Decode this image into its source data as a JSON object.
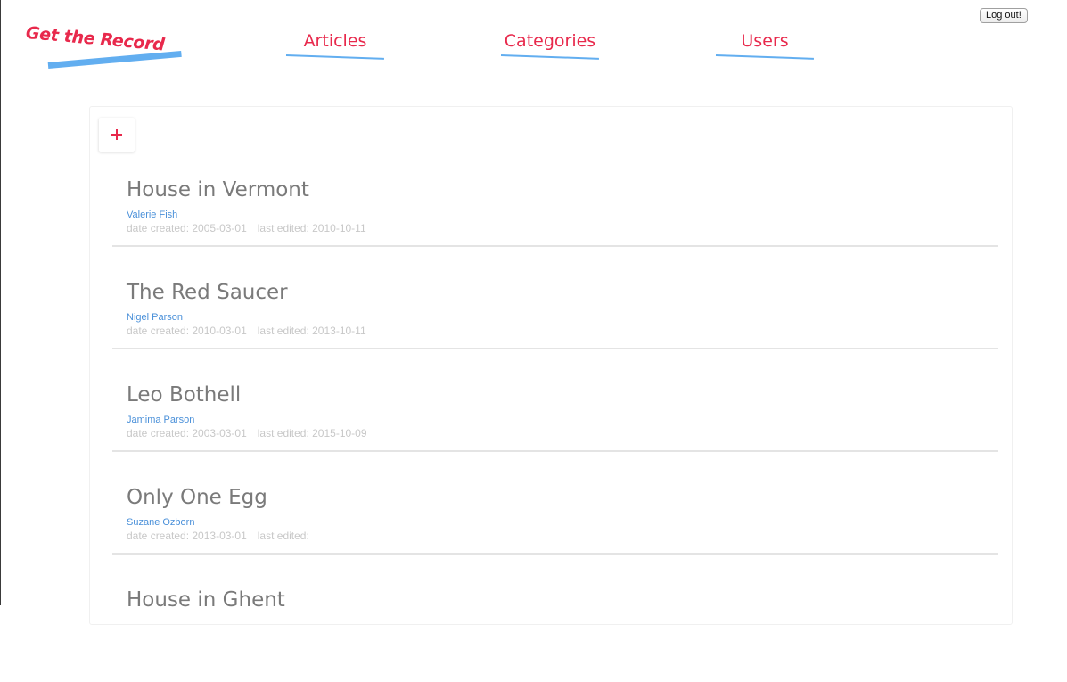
{
  "logo": {
    "text": "Get the Record",
    "colors": {
      "text": "#e8294c",
      "underline": "#62aef0"
    }
  },
  "nav": {
    "items": [
      {
        "label": "Articles"
      },
      {
        "label": "Categories"
      },
      {
        "label": "Users"
      }
    ]
  },
  "header": {
    "logout_label": "Log out!"
  },
  "toolbar": {
    "add_icon": "plus-icon"
  },
  "articles": [
    {
      "title": "House in Vermont",
      "author": "Valerie Fish",
      "created_label": "date created: 2005-03-01",
      "edited_label": "last edited: 2010-10-11"
    },
    {
      "title": "The Red Saucer",
      "author": "Nigel Parson",
      "created_label": "date created: 2010-03-01",
      "edited_label": "last edited: 2013-10-11"
    },
    {
      "title": "Leo Bothell",
      "author": "Jamima Parson",
      "created_label": "date created: 2003-03-01",
      "edited_label": "last edited: 2015-10-09"
    },
    {
      "title": "Only One Egg",
      "author": "Suzane Ozborn",
      "created_label": "date created: 2013-03-01",
      "edited_label": "last edited:"
    },
    {
      "title": "House in Ghent",
      "author": "",
      "created_label": "",
      "edited_label": ""
    }
  ],
  "colors": {
    "accent": "#e8294c",
    "underline_blue": "#62aef0",
    "title_gray": "#7a7a7a",
    "author_blue": "#4a90d9",
    "meta_gray": "#c8c8c8"
  }
}
